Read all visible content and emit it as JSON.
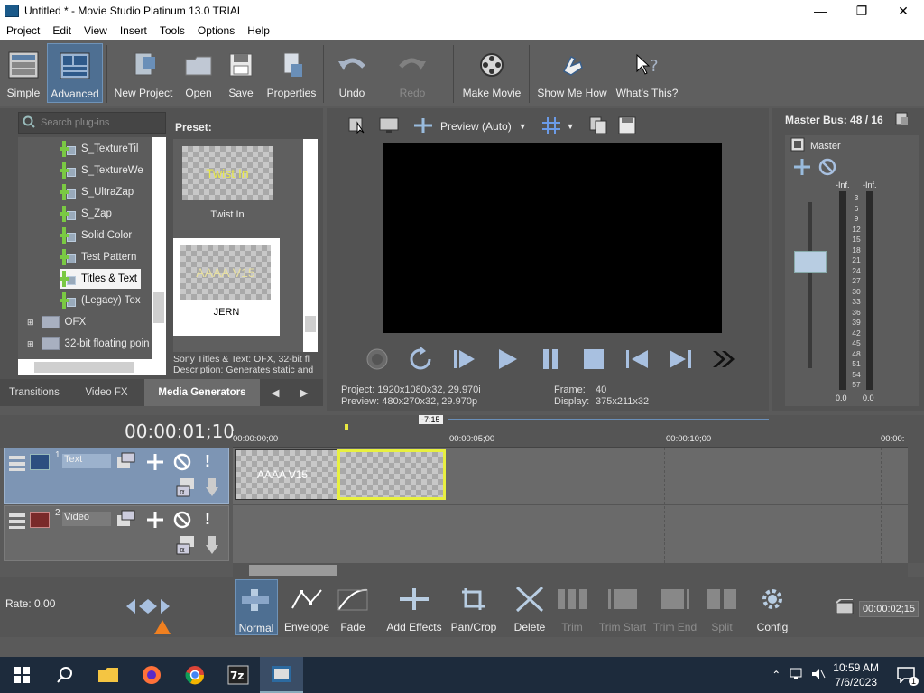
{
  "window": {
    "title": "Untitled * - Movie Studio Platinum 13.0 TRIAL",
    "minimize": "—",
    "maximize": "❐",
    "close": "✕"
  },
  "menu": [
    "Project",
    "Edit",
    "View",
    "Insert",
    "Tools",
    "Options",
    "Help"
  ],
  "toolbar": {
    "simple": "Simple",
    "advanced": "Advanced",
    "new_project": "New Project",
    "open": "Open",
    "save": "Save",
    "properties": "Properties",
    "undo": "Undo",
    "redo": "Redo",
    "make_movie": "Make Movie",
    "show_me_how": "Show Me How",
    "whats_this": "What's This?"
  },
  "plugins": {
    "search_placeholder": "Search plug-ins",
    "items": [
      "S_TextureTil",
      "S_TextureWe",
      "S_UltraZap",
      "S_Zap",
      "Solid Color",
      "Test Pattern",
      "Titles & Text",
      "(Legacy) Tex"
    ],
    "folders": [
      "OFX",
      "32-bit floating poin"
    ],
    "preset_label": "Preset:",
    "presets": [
      {
        "name": "Twist In",
        "thumb_text": "Twist In"
      },
      {
        "name": "JERN",
        "thumb_text": "AAAA V15"
      }
    ],
    "status_line1": "Sony Titles & Text: OFX, 32-bit fl",
    "status_line2": "Description: Generates static and",
    "tabs": [
      "Transitions",
      "Video FX",
      "Media Generators"
    ]
  },
  "preview": {
    "mode": "Preview (Auto)",
    "project_label": "Project:",
    "project_value": "1920x1080x32, 29.970i",
    "preview_label": "Preview:",
    "preview_value": "480x270x32, 29.970p",
    "frame_label": "Frame:",
    "frame_value": "40",
    "display_label": "Display:",
    "display_value": "375x211x32"
  },
  "master": {
    "title": "Master Bus: 48 / 16",
    "label": "Master",
    "inf_left": "-Inf.",
    "inf_right": "-Inf.",
    "scale": [
      "3",
      "6",
      "9",
      "12",
      "15",
      "18",
      "21",
      "24",
      "27",
      "30",
      "33",
      "36",
      "39",
      "42",
      "45",
      "48",
      "51",
      "54",
      "57"
    ],
    "zero_left": "0.0",
    "zero_right": "0.0"
  },
  "timeline": {
    "timecode": "00:00:01;10",
    "ruler": [
      "00:00:00;00",
      "00:00:05;00",
      "00:00:10;00",
      "00:00:"
    ],
    "marker": "-7:15",
    "tracks": [
      {
        "num": "1",
        "name": "Text"
      },
      {
        "num": "2",
        "name": "Video"
      }
    ],
    "clip_text": "AAAA V15",
    "rate": "Rate: 0.00",
    "end_time": "00:00:02;15"
  },
  "edit_tools": {
    "normal": "Normal",
    "envelope": "Envelope",
    "fade": "Fade",
    "add_effects": "Add Effects",
    "pan_crop": "Pan/Crop",
    "delete": "Delete",
    "trim": "Trim",
    "trim_start": "Trim Start",
    "trim_end": "Trim End",
    "split": "Split",
    "config": "Config"
  },
  "taskbar": {
    "time": "10:59 AM",
    "date": "7/6/2023",
    "notifications": "1"
  },
  "colors": {
    "accent": "#4e6f92",
    "clip_selected": "#e8f040",
    "track_text": "#7d95b4"
  }
}
